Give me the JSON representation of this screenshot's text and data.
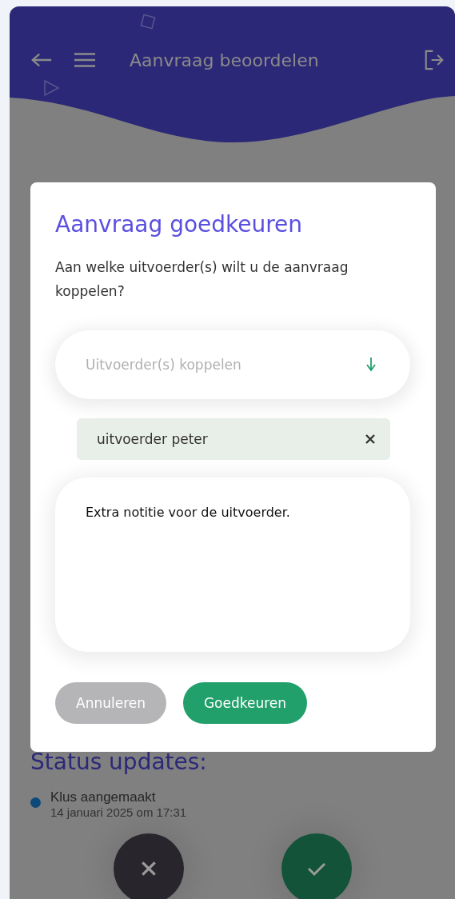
{
  "header": {
    "title": "Aanvraag beoordelen"
  },
  "status_updates": {
    "heading": "Status updates:",
    "items": [
      {
        "title": "Klus aangemaakt",
        "date": "14 januari 2025 om 17:31"
      }
    ]
  },
  "dialog": {
    "title": "Aanvraag goedkeuren",
    "question": "Aan welke uitvoerder(s) wilt u de aanvraag koppelen?",
    "select": {
      "placeholder": "Uitvoerder(s) koppelen"
    },
    "chips": [
      {
        "label": "uitvoerder peter"
      }
    ],
    "note": {
      "value": "Extra notitie voor de uitvoerder."
    },
    "buttons": [
      {
        "label": "Annuleren",
        "kind": "cancel"
      },
      {
        "label": "Goedkeuren",
        "kind": "confirm"
      }
    ]
  }
}
